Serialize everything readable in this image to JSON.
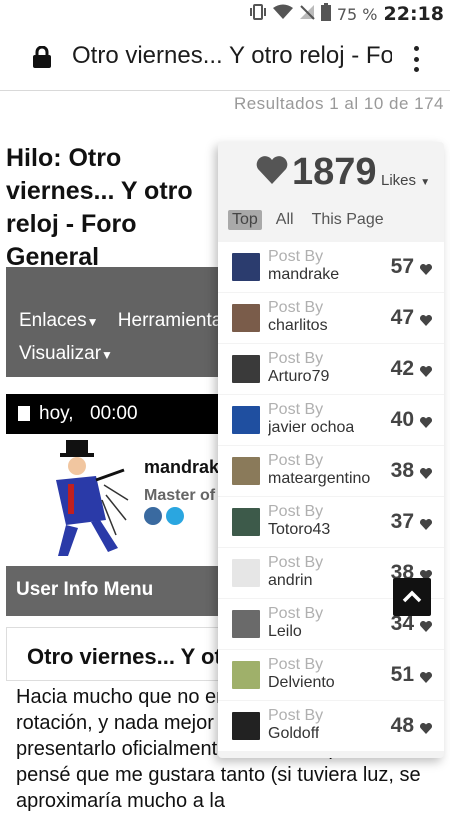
{
  "status_bar": {
    "battery": "75 %",
    "time": "22:18"
  },
  "browser": {
    "tab_title": "Otro viernes... Y otro reloj - Foro General"
  },
  "page": {
    "results": "Resultados 1 al 10 de 174",
    "thread_title": "Hilo: Otro viernes... Y otro reloj - Foro General",
    "nav": {
      "enlaces": "Enlaces",
      "herramientas": "Herramientas",
      "visualizar": "Visualizar"
    },
    "post_date": {
      "day": "hoy,",
      "time": "00:00"
    },
    "user": {
      "name": "mandrake",
      "rank": "Master of"
    },
    "user_info_menu": "User Info Menu",
    "post_title": "Otro viernes... Y otro reloj",
    "post_body": "Hacia mucho que no entraba este reloj en mi rotación, y nada mejor que un viernes para presentarlo oficialmente. Me ha sorprendido, no pensé que me gustara tanto (si tuviera luz, se aproximaría mucho a la"
  },
  "likes_popup": {
    "total": "1879",
    "likes_label": "Likes",
    "tabs": [
      "Top",
      "All",
      "This Page"
    ],
    "active_tab": "Top",
    "post_by_label": "Post By",
    "rows": [
      {
        "user": "mandrake",
        "count": "57",
        "avatar_color": "#2b3c6e"
      },
      {
        "user": "charlitos",
        "count": "47",
        "avatar_color": "#7a5c4a"
      },
      {
        "user": "Arturo79",
        "count": "42",
        "avatar_color": "#3a3a3a"
      },
      {
        "user": "javier ochoa",
        "count": "40",
        "avatar_color": "#1f4fa0"
      },
      {
        "user": "mateargentino",
        "count": "38",
        "avatar_color": "#8a7a5a"
      },
      {
        "user": "Totoro43",
        "count": "37",
        "avatar_color": "#3d5a4a"
      },
      {
        "user": "andrin",
        "count": "38",
        "avatar_color": "#e6e6e6"
      },
      {
        "user": "Leilo",
        "count": "34",
        "avatar_color": "#6a6a6a"
      },
      {
        "user": "Delviento",
        "count": "51",
        "avatar_color": "#9fb06a"
      },
      {
        "user": "Goldoff",
        "count": "48",
        "avatar_color": "#222222"
      }
    ]
  }
}
